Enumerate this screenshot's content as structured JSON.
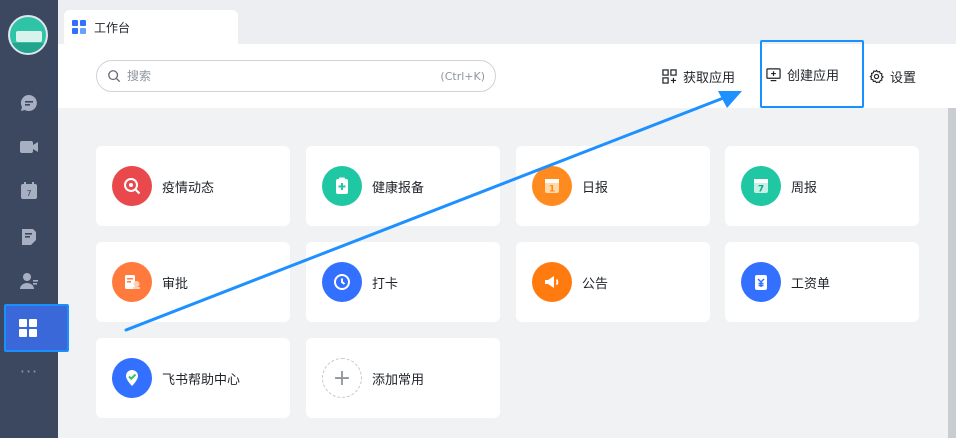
{
  "tab": {
    "title": "工作台"
  },
  "search": {
    "placeholder": "搜索",
    "shortcut": "(Ctrl+K)"
  },
  "header_actions": {
    "get_apps": "获取应用",
    "create_app": "创建应用",
    "settings": "设置"
  },
  "apps": [
    {
      "label": "疫情动态",
      "color": "#e9494c"
    },
    {
      "label": "健康报备",
      "color": "#20c7a3"
    },
    {
      "label": "日报",
      "color": "#ff8a1f"
    },
    {
      "label": "周报",
      "color": "#20c7a3"
    },
    {
      "label": "审批",
      "color": "#ff7a3c"
    },
    {
      "label": "打卡",
      "color": "#3370ff"
    },
    {
      "label": "公告",
      "color": "#ff7a0f"
    },
    {
      "label": "工资单",
      "color": "#3370ff"
    },
    {
      "label": "飞书帮助中心",
      "color": "#3370ff"
    },
    {
      "label": "添加常用",
      "color": "#8f959e"
    }
  ],
  "colors": {
    "accent": "#1890ff",
    "nav": "#3c4760"
  }
}
